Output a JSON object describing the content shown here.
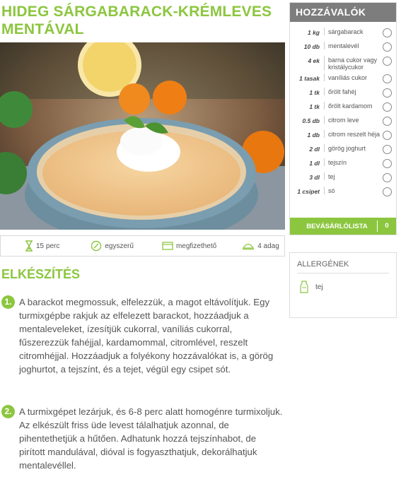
{
  "recipe": {
    "title": "HIDEG SÁRGABARACK-KRÉMLEVES MENTÁVAL"
  },
  "stats": [
    {
      "label": "15 perc",
      "icon": "hourglass-icon"
    },
    {
      "label": "egyszerű",
      "icon": "difficulty-icon"
    },
    {
      "label": "megfizethető",
      "icon": "price-icon"
    },
    {
      "label": "4 adag",
      "icon": "serving-icon"
    }
  ],
  "preparation": {
    "title": "ELKÉSZÍTÉS",
    "steps": [
      {
        "num": "1.",
        "text": "A barackot megmossuk, elfelezzük, a magot eltávolítjuk. Egy turmixgépbe rakjuk az elfelezett barackot, hozzáadjuk a mentaleveleket, ízesítjük cukorral, vaníliás cukorral, fűszerezzük fahéjjal, kardamommal, citromlével, reszelt citromhéjjal. Hozzáadjuk a folyékony hozzávalókat is, a görög joghurtot, a tejszínt, és a tejet, végül egy csipet sót."
      },
      {
        "num": "2.",
        "text": "A turmixgépet lezárjuk, és 6-8 perc alatt homogénre turmixoljuk. Az elkészült friss üde levest tálalhatjuk azonnal, de pihentethetjük a hűtően. Adhatunk hozzá tejszínhabot, de pirított mandulával, dióval is fogyaszthatjuk, dekorálhatjuk mentalevéllel."
      }
    ]
  },
  "ingredients": {
    "title": "HOZZÁVALÓK",
    "items": [
      {
        "qty": "1 kg",
        "name": "sárgabarack"
      },
      {
        "qty": "10 db",
        "name": "mentalevél"
      },
      {
        "qty": "4 ek",
        "name": "barna cukor vagy kristálycukor"
      },
      {
        "qty": "1 tasak",
        "name": "vaníliás cukor"
      },
      {
        "qty": "1 tk",
        "name": "őrölt fahéj"
      },
      {
        "qty": "1 tk",
        "name": "őrölt kardamom"
      },
      {
        "qty": "0.5 db",
        "name": "citrom leve"
      },
      {
        "qty": "1 db",
        "name": "citrom reszelt héja"
      },
      {
        "qty": "2 dl",
        "name": "görög joghurt"
      },
      {
        "qty": "1 dl",
        "name": "tejszín"
      },
      {
        "qty": "3 dl",
        "name": "tej"
      },
      {
        "qty": "1 csipet",
        "name": "só"
      }
    ],
    "shopping_label": "BEVÁSÁRLÓLISTA",
    "shopping_count": "0"
  },
  "allergens": {
    "title": "ALLERGÉNEK",
    "items": [
      {
        "name": "tej",
        "icon": "milk-icon"
      }
    ]
  },
  "colors": {
    "accent": "#8cc63f",
    "header_gray": "#7d7d7d"
  }
}
